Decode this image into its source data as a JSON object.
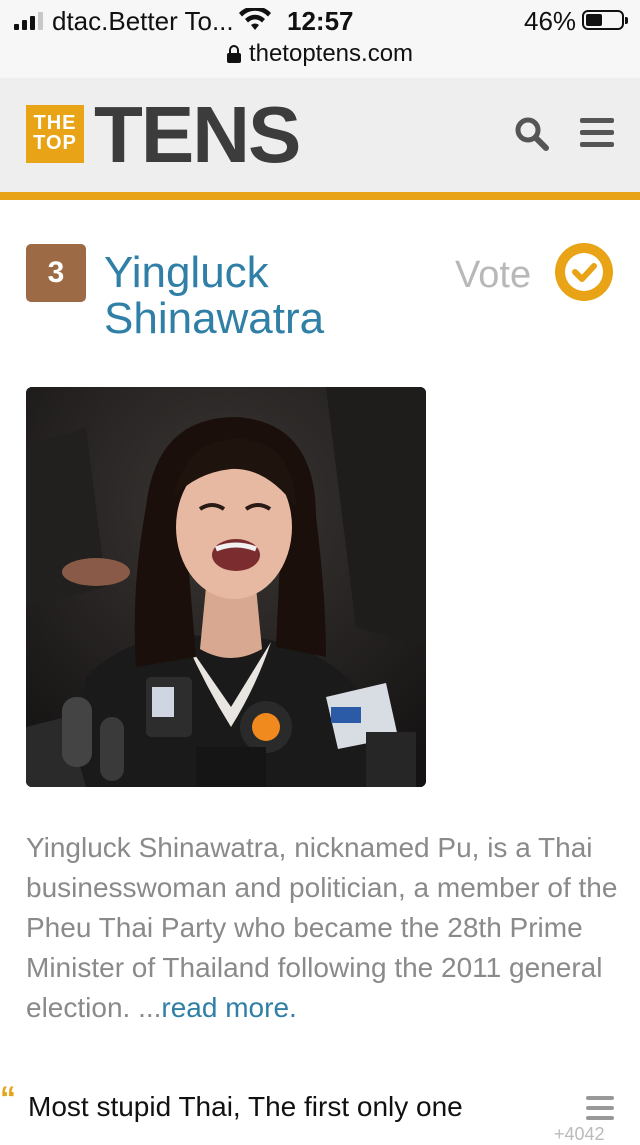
{
  "status_bar": {
    "carrier": "dtac.Better To...",
    "time": "12:57",
    "battery_percent": "46%",
    "battery_level": 0.46,
    "signal_bars": 3,
    "url": "thetoptens.com"
  },
  "header": {
    "logo_box_line1": "THE",
    "logo_box_line2": "TOP",
    "logo_text": "TENS",
    "accent_color": "#e8a317"
  },
  "item": {
    "rank": "3",
    "name": "Yingluck Shinawatra",
    "vote_label": "Vote",
    "photo_alt": "Yingluck Shinawatra",
    "description": "Yingluck Shinawatra, nicknamed Pu, is a Thai businesswoman and politician, a member of the Pheu Thai Party who became the 28th Prime Minister of Thailand following the 2011 general election. ...",
    "read_more": "read more",
    "read_more_suffix": "."
  },
  "comment": {
    "text": "Most stupid Thai, The first only one",
    "count": "+4042"
  }
}
